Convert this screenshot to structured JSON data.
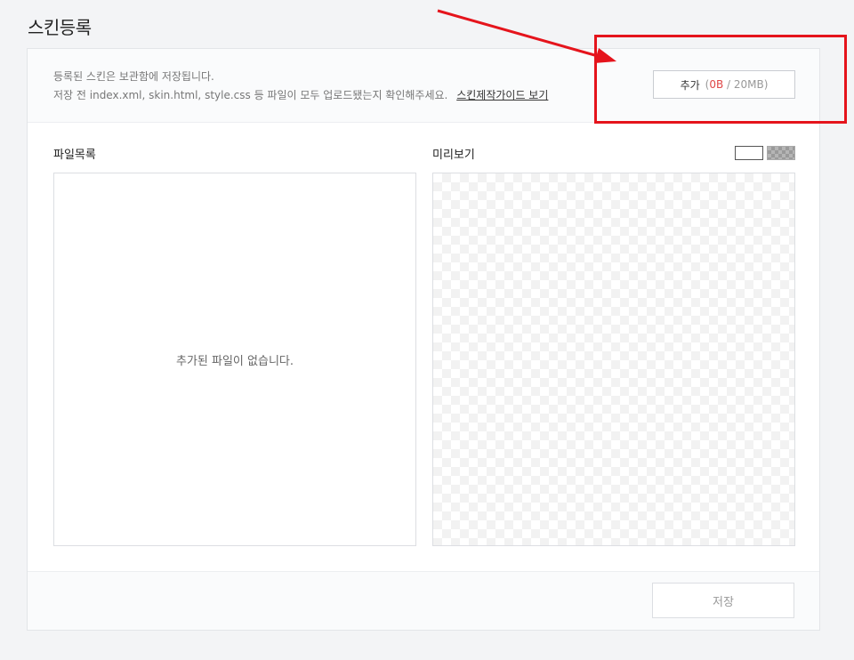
{
  "page": {
    "title": "스킨등록"
  },
  "info": {
    "line1": "등록된 스킨은 보관함에 저장됩니다.",
    "line2": "저장 전 index.xml, skin.html, style.css 등 파일이 모두 업로드됐는지 확인해주세요.",
    "guide_link": "스킨제작가이드 보기"
  },
  "add_button": {
    "label": "추가",
    "paren_open": "(",
    "used": "0B",
    "separator": " / ",
    "limit": "20MB",
    "paren_close": ")"
  },
  "file_list": {
    "title": "파일목록",
    "empty_message": "추가된 파일이 없습니다."
  },
  "preview": {
    "title": "미리보기"
  },
  "footer": {
    "save_label": "저장"
  },
  "annotation": {
    "color": "#e5141c"
  },
  "colors": {
    "usage_accent": "#e04848"
  }
}
